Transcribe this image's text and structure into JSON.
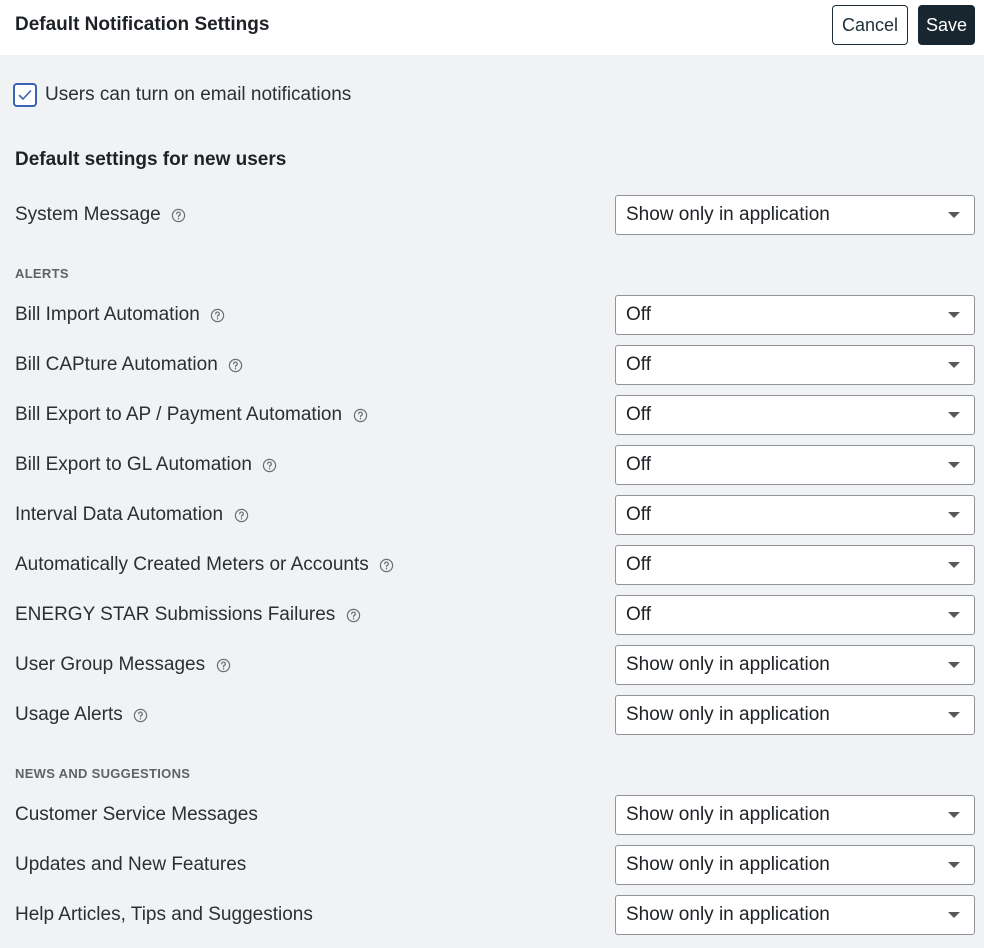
{
  "header": {
    "title": "Default Notification Settings",
    "cancel_label": "Cancel",
    "save_label": "Save"
  },
  "email_toggle": {
    "checked": true,
    "label": "Users can turn on email notifications"
  },
  "subheading": "Default settings for new users",
  "system_message": {
    "label": "System Message",
    "value": "Show only in application",
    "has_help": true
  },
  "alerts": {
    "section_label": "ALERTS",
    "items": [
      {
        "label": "Bill Import Automation",
        "value": "Off",
        "has_help": true
      },
      {
        "label": "Bill CAPture Automation",
        "value": "Off",
        "has_help": true
      },
      {
        "label": "Bill Export to AP / Payment Automation",
        "value": "Off",
        "has_help": true
      },
      {
        "label": "Bill Export to GL Automation",
        "value": "Off",
        "has_help": true
      },
      {
        "label": "Interval Data Automation",
        "value": "Off",
        "has_help": true
      },
      {
        "label": "Automatically Created Meters or Accounts",
        "value": "Off",
        "has_help": true
      },
      {
        "label": "ENERGY STAR Submissions Failures",
        "value": "Off",
        "has_help": true
      },
      {
        "label": "User Group Messages",
        "value": "Show only in application",
        "has_help": true
      },
      {
        "label": "Usage Alerts",
        "value": "Show only in application",
        "has_help": true
      }
    ]
  },
  "news": {
    "section_label": "NEWS AND SUGGESTIONS",
    "items": [
      {
        "label": "Customer Service Messages",
        "value": "Show only in application",
        "has_help": false
      },
      {
        "label": "Updates and New Features",
        "value": "Show only in application",
        "has_help": false
      },
      {
        "label": "Help Articles, Tips and Suggestions",
        "value": "Show only in application",
        "has_help": false
      }
    ]
  },
  "icons": {
    "help": "question-circle-icon",
    "dropdown": "caret-down-icon",
    "check": "checkmark-icon"
  },
  "colors": {
    "background": "#f1f2f4",
    "header_bg": "#ffffff",
    "primary_button": "#17262f",
    "checkbox_accent": "#3a63b3"
  }
}
